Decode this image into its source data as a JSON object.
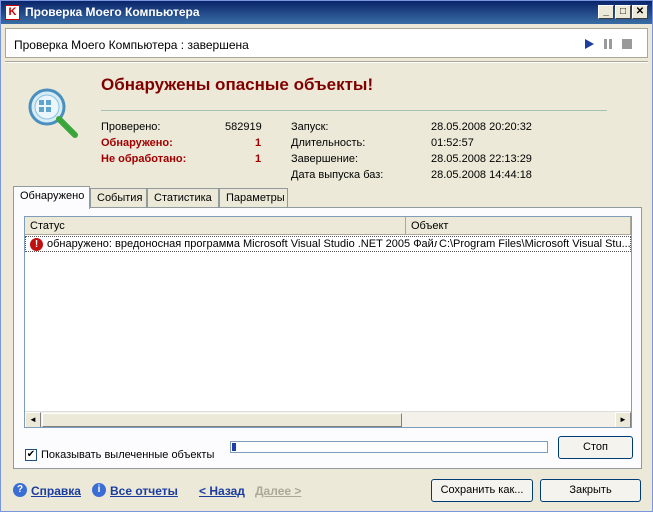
{
  "window": {
    "title": "Проверка Моего Компьютера",
    "app_icon": "K",
    "min_glyph": "_",
    "max_glyph": "□",
    "close_glyph": "✕"
  },
  "header": {
    "title": "Проверка Моего Компьютера : завершена",
    "icons": [
      "play-icon",
      "pause-icon",
      "stop-icon"
    ]
  },
  "summary": {
    "headline": "Обнаружены опасные объекты!",
    "left": [
      {
        "label": "Проверено:",
        "value": "582919"
      },
      {
        "label": "Обнаружено:",
        "value": "1"
      },
      {
        "label": "Не обработано:",
        "value": "1"
      }
    ],
    "right": [
      {
        "label": "Запуск:",
        "value": "28.05.2008 20:20:32"
      },
      {
        "label": "Длительность:",
        "value": "01:52:57"
      },
      {
        "label": "Завершение:",
        "value": "28.05.2008 22:13:29"
      },
      {
        "label": "Дата выпуска баз:",
        "value": "28.05.2008 14:44:18"
      }
    ]
  },
  "tabs": [
    "Обнаружено",
    "События",
    "Статистика",
    "Параметры"
  ],
  "table": {
    "columns": [
      "Статус",
      "Объект"
    ],
    "rows": [
      {
        "status": "обнаружено: вредоносная программа Microsoft Visual Studio .NET 2005 Файл:",
        "object": "C:\\Program Files\\Microsoft Visual Stu..."
      }
    ]
  },
  "scroll": {
    "left_arrow": "◄",
    "right_arrow": "►"
  },
  "show_cured": {
    "label": "Показывать вылеченные объекты",
    "checked": true,
    "mark": "✔"
  },
  "progress_fraction": 0.01,
  "buttons": {
    "stop": "Стоп",
    "save_as": "Сохранить как...",
    "close": "Закрыть"
  },
  "footer": {
    "help": "Справка",
    "all_reports": "Все отчеты",
    "back": "< Назад",
    "next": "Далее >",
    "help_icon_glyph": "?",
    "reports_icon_glyph": "i"
  }
}
